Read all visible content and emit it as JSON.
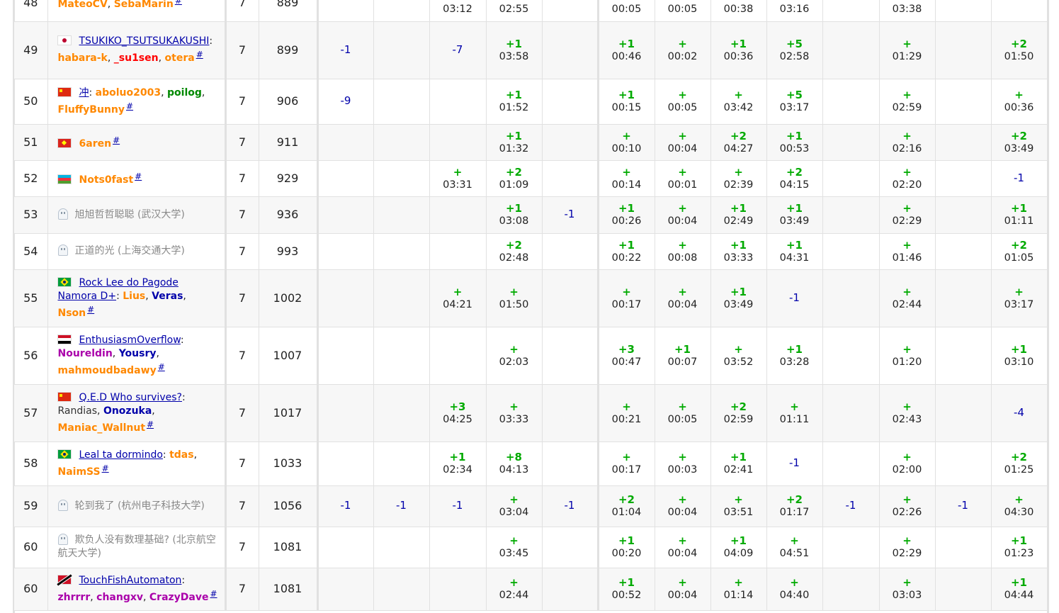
{
  "rows": [
    {
      "rank": "48",
      "flag": "none",
      "ghost": false,
      "team": "",
      "team_class": "",
      "members": [
        {
          "name": "MateoCV",
          "color": "orange"
        },
        {
          "name": "SebaMarin",
          "color": "orange"
        }
      ],
      "solved": "7",
      "penalty": "889",
      "cells": [
        null,
        null,
        {
          "t": "a",
          "v": "",
          "time": "03:12"
        },
        {
          "t": "a",
          "v": "",
          "time": "02:55"
        },
        null,
        {
          "t": "a",
          "v": "",
          "time": "00:05"
        },
        {
          "t": "a",
          "v": "",
          "time": "00:05"
        },
        {
          "t": "a",
          "v": "",
          "time": "00:38"
        },
        {
          "t": "a",
          "v": "",
          "time": "03:16"
        },
        null,
        {
          "t": "a",
          "v": "",
          "time": "03:38"
        },
        null,
        null
      ]
    },
    {
      "rank": "49",
      "flag": "jp",
      "ghost": false,
      "team": "TSUKIKO_TSUTSUKAKUSHI",
      "team_class": "team",
      "members": [
        {
          "name": "habara-k",
          "color": "orange"
        },
        {
          "name": "_su1sen",
          "color": "red"
        },
        {
          "name": "otera",
          "color": "orange"
        }
      ],
      "solved": "7",
      "penalty": "899",
      "cells": [
        {
          "t": "r",
          "v": "-1"
        },
        null,
        {
          "t": "r",
          "v": "-7"
        },
        {
          "t": "a",
          "v": "+1",
          "time": "03:58"
        },
        null,
        {
          "t": "a",
          "v": "+1",
          "time": "00:46"
        },
        {
          "t": "a",
          "v": "+",
          "time": "00:02"
        },
        {
          "t": "a",
          "v": "+1",
          "time": "00:36"
        },
        {
          "t": "a",
          "v": "+5",
          "time": "02:58"
        },
        null,
        {
          "t": "a",
          "v": "+",
          "time": "01:29"
        },
        null,
        {
          "t": "a",
          "v": "+2",
          "time": "01:50"
        }
      ]
    },
    {
      "rank": "50",
      "flag": "cn",
      "ghost": false,
      "team": "冲",
      "team_class": "team",
      "members": [
        {
          "name": "aboluo2003",
          "color": "orange"
        },
        {
          "name": "poilog",
          "color": "green"
        },
        {
          "name": "FluffyBunny",
          "color": "orange"
        }
      ],
      "solved": "7",
      "penalty": "906",
      "cells": [
        {
          "t": "r",
          "v": "-9"
        },
        null,
        null,
        {
          "t": "a",
          "v": "+1",
          "time": "01:52"
        },
        null,
        {
          "t": "a",
          "v": "+1",
          "time": "00:15"
        },
        {
          "t": "a",
          "v": "+",
          "time": "00:05"
        },
        {
          "t": "a",
          "v": "+",
          "time": "03:42"
        },
        {
          "t": "a",
          "v": "+5",
          "time": "03:17"
        },
        null,
        {
          "t": "a",
          "v": "+",
          "time": "02:59"
        },
        null,
        {
          "t": "a",
          "v": "+",
          "time": "00:36"
        }
      ]
    },
    {
      "rank": "51",
      "flag": "vn",
      "ghost": false,
      "team": "",
      "team_class": "",
      "members": [
        {
          "name": "6aren",
          "color": "orange"
        }
      ],
      "solved": "7",
      "penalty": "911",
      "cells": [
        null,
        null,
        null,
        {
          "t": "a",
          "v": "+1",
          "time": "01:32"
        },
        null,
        {
          "t": "a",
          "v": "+",
          "time": "00:10"
        },
        {
          "t": "a",
          "v": "+",
          "time": "00:04"
        },
        {
          "t": "a",
          "v": "+2",
          "time": "04:27"
        },
        {
          "t": "a",
          "v": "+1",
          "time": "00:53"
        },
        null,
        {
          "t": "a",
          "v": "+",
          "time": "02:16"
        },
        null,
        {
          "t": "a",
          "v": "+2",
          "time": "03:49"
        }
      ]
    },
    {
      "rank": "52",
      "flag": "az",
      "ghost": false,
      "team": "",
      "team_class": "",
      "members": [
        {
          "name": "Nots0fast",
          "color": "orange"
        }
      ],
      "solved": "7",
      "penalty": "929",
      "cells": [
        null,
        null,
        {
          "t": "a",
          "v": "+",
          "time": "03:31"
        },
        {
          "t": "a",
          "v": "+2",
          "time": "01:09"
        },
        null,
        {
          "t": "a",
          "v": "+",
          "time": "00:14"
        },
        {
          "t": "a",
          "v": "+",
          "time": "00:01"
        },
        {
          "t": "a",
          "v": "+",
          "time": "02:39"
        },
        {
          "t": "a",
          "v": "+2",
          "time": "04:15"
        },
        null,
        {
          "t": "a",
          "v": "+",
          "time": "02:20"
        },
        null,
        {
          "t": "r",
          "v": "-1"
        }
      ]
    },
    {
      "rank": "53",
      "flag": "none",
      "ghost": true,
      "team": "旭旭哲哲聪聪 (武汉大学)",
      "team_class": "ghostname",
      "members": [],
      "solved": "7",
      "penalty": "936",
      "cells": [
        null,
        null,
        null,
        {
          "t": "a",
          "v": "+1",
          "time": "03:08"
        },
        {
          "t": "r",
          "v": "-1"
        },
        {
          "t": "a",
          "v": "+1",
          "time": "00:26"
        },
        {
          "t": "a",
          "v": "+",
          "time": "00:04"
        },
        {
          "t": "a",
          "v": "+1",
          "time": "02:49"
        },
        {
          "t": "a",
          "v": "+1",
          "time": "03:49"
        },
        null,
        {
          "t": "a",
          "v": "+",
          "time": "02:29"
        },
        null,
        {
          "t": "a",
          "v": "+1",
          "time": "01:11"
        }
      ]
    },
    {
      "rank": "54",
      "flag": "none",
      "ghost": true,
      "team": "正道的光 (上海交通大学)",
      "team_class": "ghostname",
      "members": [],
      "solved": "7",
      "penalty": "993",
      "cells": [
        null,
        null,
        null,
        {
          "t": "a",
          "v": "+2",
          "time": "02:48"
        },
        null,
        {
          "t": "a",
          "v": "+1",
          "time": "00:22"
        },
        {
          "t": "a",
          "v": "+",
          "time": "00:08"
        },
        {
          "t": "a",
          "v": "+1",
          "time": "03:33"
        },
        {
          "t": "a",
          "v": "+1",
          "time": "04:31"
        },
        null,
        {
          "t": "a",
          "v": "+",
          "time": "01:46"
        },
        null,
        {
          "t": "a",
          "v": "+2",
          "time": "01:05"
        }
      ]
    },
    {
      "rank": "55",
      "flag": "br",
      "ghost": false,
      "team": "Rock Lee do Pagode Namora D+",
      "team_class": "team",
      "members": [
        {
          "name": "Lius",
          "color": "orange"
        },
        {
          "name": "Veras",
          "color": "blue"
        },
        {
          "name": "Nson",
          "color": "orange"
        }
      ],
      "solved": "7",
      "penalty": "1002",
      "cells": [
        null,
        null,
        {
          "t": "a",
          "v": "+",
          "time": "04:21"
        },
        {
          "t": "a",
          "v": "+",
          "time": "01:50"
        },
        null,
        {
          "t": "a",
          "v": "+",
          "time": "00:17"
        },
        {
          "t": "a",
          "v": "+",
          "time": "00:04"
        },
        {
          "t": "a",
          "v": "+1",
          "time": "03:49"
        },
        {
          "t": "r",
          "v": "-1"
        },
        null,
        {
          "t": "a",
          "v": "+",
          "time": "02:44"
        },
        null,
        {
          "t": "a",
          "v": "+",
          "time": "03:17"
        }
      ]
    },
    {
      "rank": "56",
      "flag": "eg",
      "ghost": false,
      "team": "EnthusiasmOverflow",
      "team_class": "team",
      "members": [
        {
          "name": "Noureldin",
          "color": "violet"
        },
        {
          "name": "Yousry",
          "color": "blue"
        },
        {
          "name": "mahmoudbadawy",
          "color": "orange"
        }
      ],
      "solved": "7",
      "penalty": "1007",
      "cells": [
        null,
        null,
        null,
        {
          "t": "a",
          "v": "+",
          "time": "02:03"
        },
        null,
        {
          "t": "a",
          "v": "+3",
          "time": "00:47"
        },
        {
          "t": "a",
          "v": "+1",
          "time": "00:07"
        },
        {
          "t": "a",
          "v": "+",
          "time": "03:52"
        },
        {
          "t": "a",
          "v": "+1",
          "time": "03:28"
        },
        null,
        {
          "t": "a",
          "v": "+",
          "time": "01:20"
        },
        null,
        {
          "t": "a",
          "v": "+1",
          "time": "03:10"
        }
      ]
    },
    {
      "rank": "57",
      "flag": "cn",
      "ghost": false,
      "team": "Q.E.D Who survives?",
      "team_class": "team",
      "members": [
        {
          "name": "Randias",
          "color": "gray"
        },
        {
          "name": "Onozuka",
          "color": "blue"
        },
        {
          "name": "Maniac_Wallnut",
          "color": "orange"
        }
      ],
      "solved": "7",
      "penalty": "1017",
      "cells": [
        null,
        null,
        {
          "t": "a",
          "v": "+3",
          "time": "04:25"
        },
        {
          "t": "a",
          "v": "+",
          "time": "03:33"
        },
        null,
        {
          "t": "a",
          "v": "+",
          "time": "00:21"
        },
        {
          "t": "a",
          "v": "+",
          "time": "00:05"
        },
        {
          "t": "a",
          "v": "+2",
          "time": "02:59"
        },
        {
          "t": "a",
          "v": "+",
          "time": "01:11"
        },
        null,
        {
          "t": "a",
          "v": "+",
          "time": "02:43"
        },
        null,
        {
          "t": "r",
          "v": "-4"
        }
      ]
    },
    {
      "rank": "58",
      "flag": "br",
      "ghost": false,
      "team": "Leal ta dormindo",
      "team_class": "team",
      "members": [
        {
          "name": "tdas",
          "color": "orange"
        },
        {
          "name": "NaimSS",
          "color": "orange"
        }
      ],
      "solved": "7",
      "penalty": "1033",
      "cells": [
        null,
        null,
        {
          "t": "a",
          "v": "+1",
          "time": "02:34"
        },
        {
          "t": "a",
          "v": "+8",
          "time": "04:13"
        },
        null,
        {
          "t": "a",
          "v": "+",
          "time": "00:17"
        },
        {
          "t": "a",
          "v": "+",
          "time": "00:03"
        },
        {
          "t": "a",
          "v": "+1",
          "time": "02:41"
        },
        {
          "t": "r",
          "v": "-1"
        },
        null,
        {
          "t": "a",
          "v": "+",
          "time": "02:00"
        },
        null,
        {
          "t": "a",
          "v": "+2",
          "time": "01:25"
        }
      ]
    },
    {
      "rank": "59",
      "flag": "none",
      "ghost": true,
      "team": "轮到我了 (杭州电子科技大学)",
      "team_class": "ghostname",
      "members": [],
      "solved": "7",
      "penalty": "1056",
      "cells": [
        {
          "t": "r",
          "v": "-1"
        },
        {
          "t": "r",
          "v": "-1"
        },
        {
          "t": "r",
          "v": "-1"
        },
        {
          "t": "a",
          "v": "+",
          "time": "03:04"
        },
        {
          "t": "r",
          "v": "-1"
        },
        {
          "t": "a",
          "v": "+2",
          "time": "01:04"
        },
        {
          "t": "a",
          "v": "+",
          "time": "00:04"
        },
        {
          "t": "a",
          "v": "+",
          "time": "03:51"
        },
        {
          "t": "a",
          "v": "+2",
          "time": "01:17"
        },
        {
          "t": "r",
          "v": "-1"
        },
        {
          "t": "a",
          "v": "+",
          "time": "02:26"
        },
        {
          "t": "r",
          "v": "-1"
        },
        {
          "t": "a",
          "v": "+",
          "time": "04:30"
        }
      ]
    },
    {
      "rank": "60",
      "flag": "none",
      "ghost": true,
      "team": "欺负人没有数理基础? (北京航空航天大学)",
      "team_class": "ghostname",
      "members": [],
      "solved": "7",
      "penalty": "1081",
      "cells": [
        null,
        null,
        null,
        {
          "t": "a",
          "v": "+",
          "time": "03:45"
        },
        null,
        {
          "t": "a",
          "v": "+1",
          "time": "00:20"
        },
        {
          "t": "a",
          "v": "+",
          "time": "00:04"
        },
        {
          "t": "a",
          "v": "+1",
          "time": "04:09"
        },
        {
          "t": "a",
          "v": "+",
          "time": "04:51"
        },
        null,
        {
          "t": "a",
          "v": "+",
          "time": "02:29"
        },
        null,
        {
          "t": "a",
          "v": "+1",
          "time": "01:23"
        }
      ]
    },
    {
      "rank": "60",
      "flag": "tt",
      "ghost": false,
      "team": "TouchFishAutomaton",
      "team_class": "team",
      "members": [
        {
          "name": "zhrrrr",
          "color": "violet"
        },
        {
          "name": "changxv",
          "color": "violet"
        },
        {
          "name": "CrazyDave",
          "color": "violet"
        }
      ],
      "solved": "7",
      "penalty": "1081",
      "cells": [
        null,
        null,
        null,
        {
          "t": "a",
          "v": "+",
          "time": "02:44"
        },
        null,
        {
          "t": "a",
          "v": "+1",
          "time": "00:52"
        },
        {
          "t": "a",
          "v": "+",
          "time": "00:04"
        },
        {
          "t": "a",
          "v": "+",
          "time": "01:14"
        },
        {
          "t": "a",
          "v": "+",
          "time": "04:40"
        },
        null,
        {
          "t": "a",
          "v": "+",
          "time": "03:03"
        },
        null,
        {
          "t": "a",
          "v": "+1",
          "time": "04:44"
        }
      ]
    }
  ],
  "flags": {
    "jp": {
      "bg": "#ffffff",
      "mark": "#bc002d"
    },
    "cn": {
      "bg": "#de2910",
      "mark": "#ffde00"
    },
    "vn": {
      "bg": "#da251d",
      "mark": "#ffff00"
    },
    "az": {
      "top": "#00b5e2",
      "mid": "#ef3340",
      "bot": "#509e2f"
    },
    "br": {
      "bg": "#009c3b",
      "mark": "#ffdf00",
      "inner": "#002776"
    },
    "eg": {
      "top": "#ce1126",
      "mid": "#ffffff",
      "bot": "#000000"
    },
    "tt": {
      "bg": "#ce1126",
      "mark": "#000000"
    }
  },
  "hash_label": "#"
}
